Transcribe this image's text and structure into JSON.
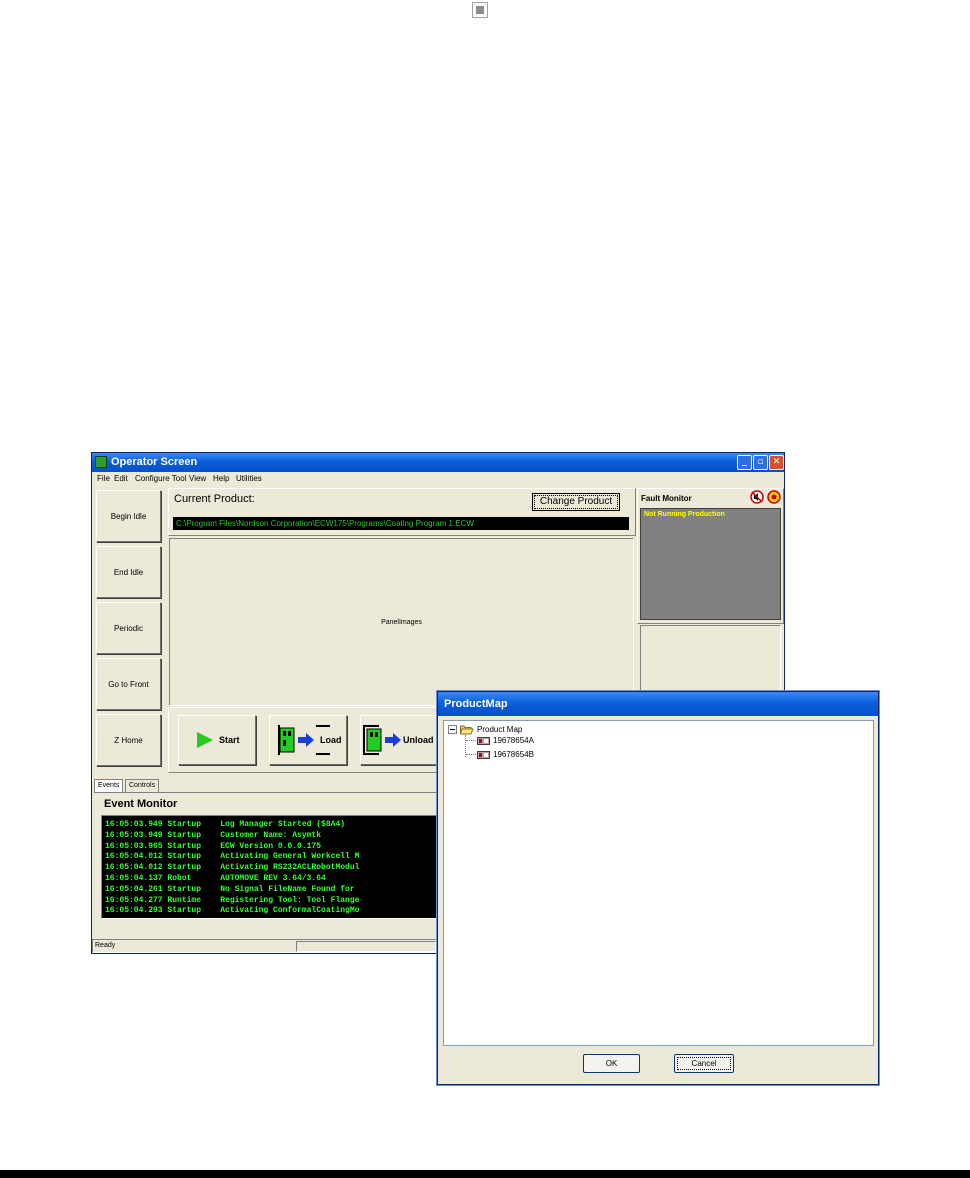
{
  "operator_window": {
    "title": "Operator Screen",
    "menu": [
      "File",
      "Edit",
      "Configure Tool",
      "View",
      "Help",
      "Utilities"
    ],
    "left_buttons": [
      "Begin Idle",
      "End Idle",
      "Periodic",
      "Go to Front",
      "Z Home"
    ],
    "current_product_label": "Current Product:",
    "change_product_button": "Change Product",
    "product_path": "C:\\Program Files\\Nordson Corporation\\ECW175\\Programs\\Coating Program 1.ECW",
    "panel_images_label": "PanelImages",
    "action_buttons": [
      "Start",
      "Load",
      "Unload"
    ],
    "fault_monitor": {
      "title": "Fault Monitor",
      "status": "Not Running Production"
    },
    "tabs": [
      "Events",
      "Controls"
    ],
    "event_monitor": {
      "title": "Event Monitor",
      "rows": [
        {
          "time": "16:05:03.949",
          "source": "Startup",
          "message": "Log Manager Started ($8A4)"
        },
        {
          "time": "16:05:03.949",
          "source": "Startup",
          "message": "Customer Name: Asymtk"
        },
        {
          "time": "16:05:03.965",
          "source": "Startup",
          "message": "ECW Version 0.0.0.175"
        },
        {
          "time": "16:05:04.012",
          "source": "Startup",
          "message": "Activating General Workcell M"
        },
        {
          "time": "16:05:04.012",
          "source": "Startup",
          "message": "Activating RS232ACLRobotModul"
        },
        {
          "time": "16:05:04.137",
          "source": "Robot",
          "message": "AUTOMOVE REV 3.64/3.64"
        },
        {
          "time": "16:05:04.261",
          "source": "Startup",
          "message": "No Signal FileName Found for"
        },
        {
          "time": "16:05:04.277",
          "source": "Runtime",
          "message": "Registering Tool: Tool Flange"
        },
        {
          "time": "16:05:04.293",
          "source": "Startup",
          "message": "Activating ConformalCoatingMo"
        }
      ]
    },
    "status": "Ready"
  },
  "product_map_dialog": {
    "title": "ProductMap",
    "root_label": "Product Map",
    "items": [
      "19678654A",
      "19678654B"
    ],
    "ok_button": "OK",
    "cancel_button": "Cancel"
  },
  "colors": {
    "titlebar": "#0a5fd8",
    "window_bg": "#ece9d8",
    "console_text": "#33ff33",
    "fault_text": "#ffff00"
  }
}
